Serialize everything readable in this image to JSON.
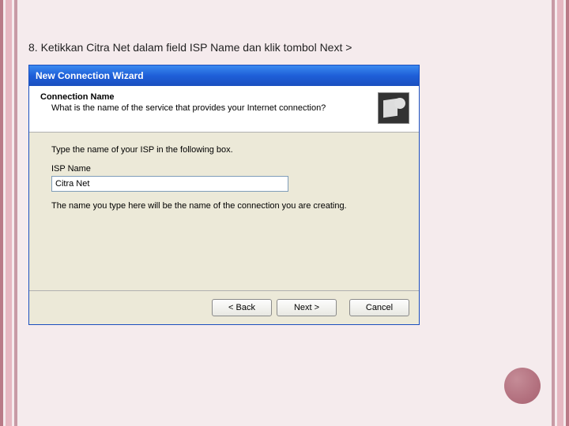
{
  "instruction": "8. Ketikkan Citra Net dalam field ISP Name dan klik tombol Next >",
  "wizard": {
    "title": "New Connection Wizard",
    "header_title": "Connection Name",
    "header_sub": "What is the name of the service that provides your Internet connection?",
    "prompt": "Type the name of your ISP in the following box.",
    "field_label": "ISP Name",
    "field_value": "Citra Net",
    "note": "The name you type here will be the name of the connection you are creating.",
    "buttons": {
      "back": "< Back",
      "next": "Next >",
      "cancel": "Cancel"
    }
  }
}
